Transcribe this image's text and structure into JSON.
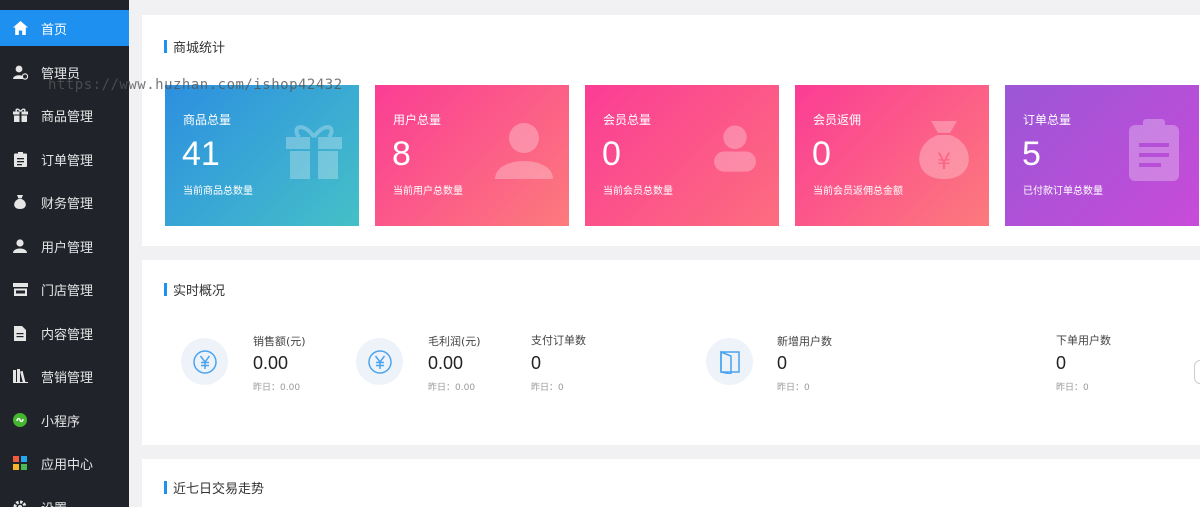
{
  "sidebar": {
    "items": [
      {
        "label": "首页",
        "icon": "home-icon",
        "active": true
      },
      {
        "label": "管理员",
        "icon": "user-gear-icon"
      },
      {
        "label": "商品管理",
        "icon": "gift-icon"
      },
      {
        "label": "订单管理",
        "icon": "clipboard-icon"
      },
      {
        "label": "财务管理",
        "icon": "money-bag-icon"
      },
      {
        "label": "用户管理",
        "icon": "user-icon"
      },
      {
        "label": "门店管理",
        "icon": "store-icon"
      },
      {
        "label": "内容管理",
        "icon": "document-icon"
      },
      {
        "label": "营销管理",
        "icon": "books-icon"
      },
      {
        "label": "小程序",
        "icon": "mini-program-icon"
      },
      {
        "label": "应用中心",
        "icon": "apps-icon"
      },
      {
        "label": "设置",
        "icon": "gear-icon"
      }
    ]
  },
  "watermark": "https://www.huzhan.com/ishop42432",
  "mall_stats": {
    "title": "商城统计",
    "cards": [
      {
        "title": "商品总量",
        "value": "41",
        "sub": "当前商品总数量",
        "icon": "gift-icon",
        "gradient": [
          "#2d8fe0",
          "#45c0c8"
        ]
      },
      {
        "title": "用户总量",
        "value": "8",
        "sub": "当前用户总数量",
        "icon": "user-icon",
        "gradient": [
          "#fb3d95",
          "#fc7a7c"
        ]
      },
      {
        "title": "会员总量",
        "value": "0",
        "sub": "当前会员总数量",
        "icon": "member-icon",
        "gradient": [
          "#fb3d95",
          "#fc6d7e"
        ]
      },
      {
        "title": "会员返佣",
        "value": "0",
        "sub": "当前会员返佣总金额",
        "icon": "money-bag-icon",
        "gradient": [
          "#fb3d95",
          "#fc7a7c"
        ]
      },
      {
        "title": "订单总量",
        "value": "5",
        "sub": "已付款订单总数量",
        "icon": "clipboard-icon",
        "gradient": [
          "#9b56d6",
          "#c84bd9"
        ]
      }
    ]
  },
  "realtime": {
    "title": "实时概况",
    "items": [
      {
        "label": "销售额(元)",
        "value": "0.00",
        "prev": "昨日：0.00",
        "icon": "yuan-icon"
      },
      {
        "label": "毛利润(元)",
        "value": "0.00",
        "prev": "昨日：0.00",
        "icon": "yuan-icon"
      },
      {
        "label": "支付订单数",
        "value": "0",
        "prev": "昨日：0"
      },
      {
        "label": "新增用户数",
        "value": "0",
        "prev": "昨日：0",
        "icon": "door-icon"
      },
      {
        "label": "下单用户数",
        "value": "0",
        "prev": "昨日：0"
      }
    ]
  },
  "trend": {
    "title": "近七日交易走势"
  }
}
